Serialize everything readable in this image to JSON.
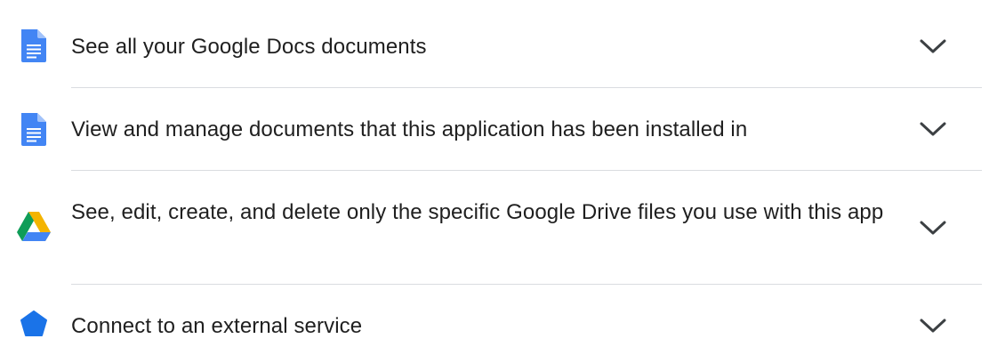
{
  "permissions": [
    {
      "label": "See all your Google Docs documents",
      "icon": "google-docs-icon",
      "expand_icon": "chevron-down-icon"
    },
    {
      "label": "View and manage documents that this application has been installed in",
      "icon": "google-docs-icon",
      "expand_icon": "chevron-down-icon"
    },
    {
      "label": "See, edit, create, and delete only the specific Google Drive files you use with this app",
      "icon": "google-drive-icon",
      "expand_icon": "chevron-down-icon"
    },
    {
      "label": "Connect to an external service",
      "icon": "external-service-icon",
      "expand_icon": "chevron-down-icon"
    }
  ],
  "colors": {
    "docs_blue": "#4285f4",
    "docs_blue_dark": "#3367d6",
    "drive_green": "#0f9d58",
    "drive_yellow": "#f4b400",
    "drive_blue": "#4285f4",
    "external_blue": "#1a73e8",
    "text": "#1f1f1f",
    "divider": "#dadce0",
    "chevron": "#3c4043"
  }
}
